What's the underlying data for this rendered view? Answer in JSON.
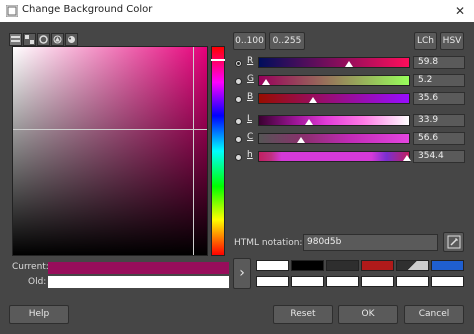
{
  "window": {
    "title": "Change Background Color",
    "close_glyph": "✕"
  },
  "tabs": [
    {
      "name": "scales-tab",
      "icon": "scales-icon"
    },
    {
      "name": "grid-tab",
      "icon": "grid-icon"
    },
    {
      "name": "wheel-tab",
      "icon": "wheel-icon"
    },
    {
      "name": "triangle-tab",
      "icon": "triangle-icon"
    },
    {
      "name": "palette-tab",
      "icon": "palette-icon"
    }
  ],
  "range_buttons": {
    "r100": "0..100",
    "r255": "0..255"
  },
  "model_buttons": {
    "lch": "LCh",
    "hsv": "HSV"
  },
  "sliders": [
    {
      "label": "R",
      "value": "59.8"
    },
    {
      "label": "G",
      "value": "5.2"
    },
    {
      "label": "B",
      "value": "35.6"
    },
    {
      "label": "L",
      "value": "33.9"
    },
    {
      "label": "C",
      "value": "56.6"
    },
    {
      "label": "h",
      "value": "354.4"
    }
  ],
  "html_notation": {
    "label": "HTML notation:",
    "value": "980d5b"
  },
  "current": {
    "label": "Current:",
    "color": "#980d5b"
  },
  "old": {
    "label": "Old:",
    "color": "#ffffff"
  },
  "history_colors": [
    "#ffffff",
    "#000000",
    "#2e2e2e",
    "#b01a1a",
    "#404040",
    "#1f5fd0",
    "#ffffff",
    "#ffffff",
    "#ffffff",
    "#ffffff",
    "#ffffff",
    "#ffffff"
  ],
  "buttons": {
    "help": "Help",
    "reset": "Reset",
    "ok": "OK",
    "cancel": "Cancel"
  },
  "arrow_glyph": "›"
}
